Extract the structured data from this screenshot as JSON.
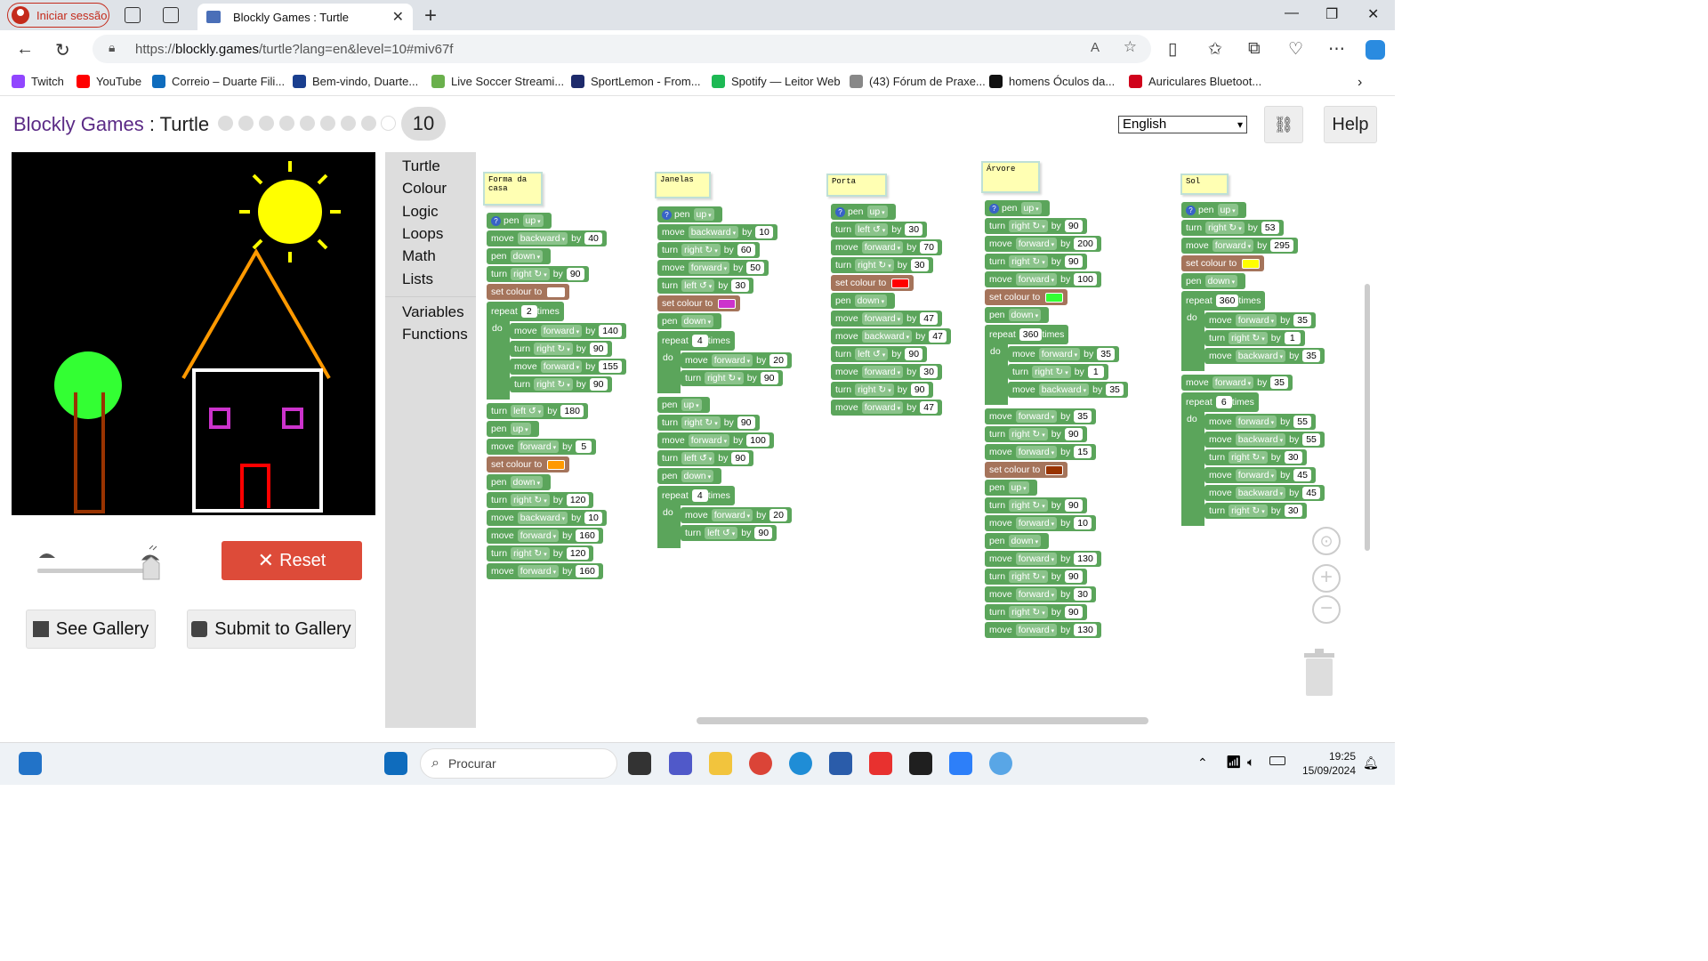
{
  "browser": {
    "signin_label": "Iniciar sessão",
    "tab_title": "Blockly Games : Turtle",
    "url_prefix": "https://",
    "url_domain": "blockly.games",
    "url_path": "/turtle?lang=en&level=10#miv67f",
    "bookmarks": [
      "Twitch",
      "YouTube",
      "Correio – Duarte Fili...",
      "Bem-vindo, Duarte...",
      "Live Soccer Streami...",
      "SportLemon - From...",
      "Spotify — Leitor Web",
      "(43) Fórum de Praxe...",
      "homens Óculos da...",
      "Auriculares Bluetoot..."
    ],
    "bookmark_colors": [
      "#9146ff",
      "#ff0000",
      "#0f6cbd",
      "#1a3f8f",
      "#6ab04c",
      "#1d2a6b",
      "#1db954",
      "#888888",
      "#111111",
      "#d0021b"
    ]
  },
  "app": {
    "title_brand": "Blockly Games",
    "title_sep": " : ",
    "title_game": "Turtle",
    "level": "10",
    "language": "English",
    "help_label": "Help",
    "reset_label": "Reset",
    "see_gallery_label": "See Gallery",
    "submit_gallery_label": "Submit to Gallery"
  },
  "toolbox": [
    "Turtle",
    "Colour",
    "Logic",
    "Loops",
    "Math",
    "Lists",
    "Variables",
    "Functions"
  ],
  "workspace": {
    "comments": [
      "Forma da\ncasa",
      "Janelas",
      "Porta",
      "Árvore",
      "Sol"
    ],
    "stacks": [
      {
        "blocks": [
          [
            "pen",
            "up"
          ],
          [
            "move",
            "backward",
            "40"
          ],
          [
            "pen",
            "down"
          ],
          [
            "turn",
            "right ↻",
            "90"
          ],
          [
            "colour",
            "#ffffff"
          ],
          [
            "repeat",
            "2"
          ],
          [
            "move",
            "forward",
            "140"
          ],
          [
            "turn",
            "right ↻",
            "90"
          ],
          [
            "move",
            "forward",
            "155"
          ],
          [
            "turn",
            "right ↻",
            "90"
          ],
          [
            "turn",
            "left ↺",
            "180"
          ],
          [
            "pen",
            "up"
          ],
          [
            "move",
            "forward",
            "5"
          ],
          [
            "colour",
            "#ff9900"
          ],
          [
            "pen",
            "down"
          ],
          [
            "turn",
            "right ↻",
            "120"
          ],
          [
            "move",
            "backward",
            "10"
          ],
          [
            "move",
            "forward",
            "160"
          ],
          [
            "turn",
            "right ↻",
            "120"
          ],
          [
            "move",
            "forward",
            "160"
          ]
        ]
      },
      {
        "blocks": [
          [
            "pen",
            "up"
          ],
          [
            "move",
            "backward",
            "10"
          ],
          [
            "turn",
            "right ↻",
            "60"
          ],
          [
            "move",
            "forward",
            "50"
          ],
          [
            "turn",
            "left ↺",
            "30"
          ],
          [
            "colour",
            "#cc33cc"
          ],
          [
            "pen",
            "down"
          ],
          [
            "repeat",
            "4"
          ],
          [
            "move",
            "forward",
            "20"
          ],
          [
            "turn",
            "right ↻",
            "90"
          ],
          [
            "pen",
            "up"
          ],
          [
            "turn",
            "right ↻",
            "90"
          ],
          [
            "move",
            "forward",
            "100"
          ],
          [
            "turn",
            "left ↺",
            "90"
          ],
          [
            "pen",
            "down"
          ],
          [
            "repeat",
            "4"
          ],
          [
            "move",
            "forward",
            "20"
          ],
          [
            "turn",
            "left ↺",
            "90"
          ]
        ]
      },
      {
        "blocks": [
          [
            "pen",
            "up"
          ],
          [
            "turn",
            "left ↺",
            "30"
          ],
          [
            "move",
            "forward",
            "70"
          ],
          [
            "turn",
            "right ↻",
            "30"
          ],
          [
            "colour",
            "#ff0000"
          ],
          [
            "pen",
            "down"
          ],
          [
            "move",
            "forward",
            "47"
          ],
          [
            "move",
            "backward",
            "47"
          ],
          [
            "turn",
            "left ↺",
            "90"
          ],
          [
            "move",
            "forward",
            "30"
          ],
          [
            "turn",
            "right ↻",
            "90"
          ],
          [
            "move",
            "forward",
            "47"
          ]
        ]
      },
      {
        "blocks": [
          [
            "pen",
            "up"
          ],
          [
            "turn",
            "right ↻",
            "90"
          ],
          [
            "move",
            "forward",
            "200"
          ],
          [
            "turn",
            "right ↻",
            "90"
          ],
          [
            "move",
            "forward",
            "100"
          ],
          [
            "colour",
            "#33ff33"
          ],
          [
            "pen",
            "down"
          ],
          [
            "repeat",
            "360"
          ],
          [
            "move",
            "forward",
            "35"
          ],
          [
            "turn",
            "right ↻",
            "1"
          ],
          [
            "move",
            "backward",
            "35"
          ],
          [
            "move",
            "forward",
            "35"
          ],
          [
            "turn",
            "right ↻",
            "90"
          ],
          [
            "move",
            "forward",
            "15"
          ],
          [
            "colour",
            "#993300"
          ],
          [
            "pen",
            "up"
          ],
          [
            "turn",
            "right ↻",
            "90"
          ],
          [
            "move",
            "forward",
            "10"
          ],
          [
            "pen",
            "down"
          ],
          [
            "move",
            "forward",
            "130"
          ],
          [
            "turn",
            "right ↻",
            "90"
          ],
          [
            "move",
            "forward",
            "30"
          ],
          [
            "turn",
            "right ↻",
            "90"
          ],
          [
            "move",
            "forward",
            "130"
          ]
        ]
      },
      {
        "blocks": [
          [
            "pen",
            "up"
          ],
          [
            "turn",
            "right ↻",
            "53"
          ],
          [
            "move",
            "forward",
            "295"
          ],
          [
            "colour",
            "#ffff00"
          ],
          [
            "pen",
            "down"
          ],
          [
            "repeat",
            "360"
          ],
          [
            "move",
            "forward",
            "35"
          ],
          [
            "turn",
            "right ↻",
            "1"
          ],
          [
            "move",
            "backward",
            "35"
          ],
          [
            "move",
            "forward",
            "35"
          ],
          [
            "repeat",
            "6"
          ],
          [
            "move",
            "forward",
            "55"
          ],
          [
            "move",
            "backward",
            "55"
          ],
          [
            "turn",
            "right ↻",
            "30"
          ],
          [
            "move",
            "forward",
            "45"
          ],
          [
            "move",
            "backward",
            "45"
          ],
          [
            "turn",
            "right ↻",
            "30"
          ]
        ]
      }
    ]
  },
  "labels": {
    "pen": "pen",
    "move": "move",
    "turn": "turn",
    "by": "by",
    "set_colour": "set colour to",
    "repeat": "repeat",
    "times": "times",
    "do": "do"
  },
  "taskbar": {
    "search_placeholder": "Procurar",
    "time": "19:25",
    "date": "15/09/2024"
  }
}
